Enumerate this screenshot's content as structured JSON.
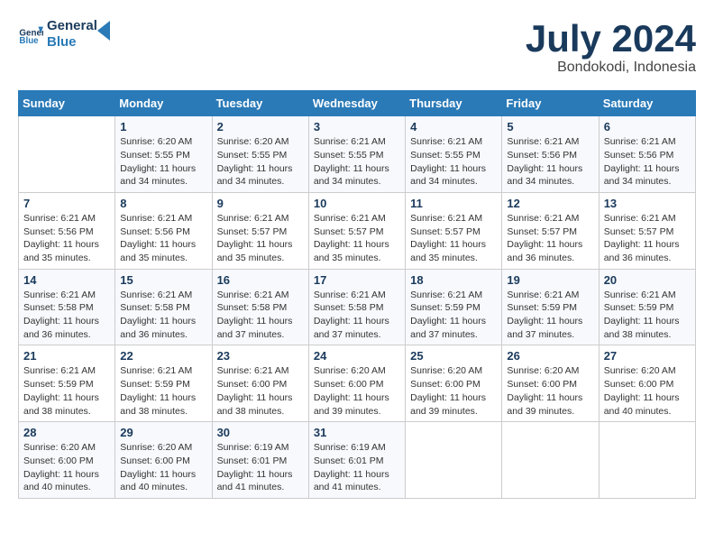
{
  "header": {
    "logo_line1": "General",
    "logo_line2": "Blue",
    "month_title": "July 2024",
    "location": "Bondokodi, Indonesia"
  },
  "weekdays": [
    "Sunday",
    "Monday",
    "Tuesday",
    "Wednesday",
    "Thursday",
    "Friday",
    "Saturday"
  ],
  "weeks": [
    [
      {
        "day": "",
        "info": ""
      },
      {
        "day": "1",
        "info": "Sunrise: 6:20 AM\nSunset: 5:55 PM\nDaylight: 11 hours\nand 34 minutes."
      },
      {
        "day": "2",
        "info": "Sunrise: 6:20 AM\nSunset: 5:55 PM\nDaylight: 11 hours\nand 34 minutes."
      },
      {
        "day": "3",
        "info": "Sunrise: 6:21 AM\nSunset: 5:55 PM\nDaylight: 11 hours\nand 34 minutes."
      },
      {
        "day": "4",
        "info": "Sunrise: 6:21 AM\nSunset: 5:55 PM\nDaylight: 11 hours\nand 34 minutes."
      },
      {
        "day": "5",
        "info": "Sunrise: 6:21 AM\nSunset: 5:56 PM\nDaylight: 11 hours\nand 34 minutes."
      },
      {
        "day": "6",
        "info": "Sunrise: 6:21 AM\nSunset: 5:56 PM\nDaylight: 11 hours\nand 34 minutes."
      }
    ],
    [
      {
        "day": "7",
        "info": "Sunrise: 6:21 AM\nSunset: 5:56 PM\nDaylight: 11 hours\nand 35 minutes."
      },
      {
        "day": "8",
        "info": "Sunrise: 6:21 AM\nSunset: 5:56 PM\nDaylight: 11 hours\nand 35 minutes."
      },
      {
        "day": "9",
        "info": "Sunrise: 6:21 AM\nSunset: 5:57 PM\nDaylight: 11 hours\nand 35 minutes."
      },
      {
        "day": "10",
        "info": "Sunrise: 6:21 AM\nSunset: 5:57 PM\nDaylight: 11 hours\nand 35 minutes."
      },
      {
        "day": "11",
        "info": "Sunrise: 6:21 AM\nSunset: 5:57 PM\nDaylight: 11 hours\nand 35 minutes."
      },
      {
        "day": "12",
        "info": "Sunrise: 6:21 AM\nSunset: 5:57 PM\nDaylight: 11 hours\nand 36 minutes."
      },
      {
        "day": "13",
        "info": "Sunrise: 6:21 AM\nSunset: 5:57 PM\nDaylight: 11 hours\nand 36 minutes."
      }
    ],
    [
      {
        "day": "14",
        "info": "Sunrise: 6:21 AM\nSunset: 5:58 PM\nDaylight: 11 hours\nand 36 minutes."
      },
      {
        "day": "15",
        "info": "Sunrise: 6:21 AM\nSunset: 5:58 PM\nDaylight: 11 hours\nand 36 minutes."
      },
      {
        "day": "16",
        "info": "Sunrise: 6:21 AM\nSunset: 5:58 PM\nDaylight: 11 hours\nand 37 minutes."
      },
      {
        "day": "17",
        "info": "Sunrise: 6:21 AM\nSunset: 5:58 PM\nDaylight: 11 hours\nand 37 minutes."
      },
      {
        "day": "18",
        "info": "Sunrise: 6:21 AM\nSunset: 5:59 PM\nDaylight: 11 hours\nand 37 minutes."
      },
      {
        "day": "19",
        "info": "Sunrise: 6:21 AM\nSunset: 5:59 PM\nDaylight: 11 hours\nand 37 minutes."
      },
      {
        "day": "20",
        "info": "Sunrise: 6:21 AM\nSunset: 5:59 PM\nDaylight: 11 hours\nand 38 minutes."
      }
    ],
    [
      {
        "day": "21",
        "info": "Sunrise: 6:21 AM\nSunset: 5:59 PM\nDaylight: 11 hours\nand 38 minutes."
      },
      {
        "day": "22",
        "info": "Sunrise: 6:21 AM\nSunset: 5:59 PM\nDaylight: 11 hours\nand 38 minutes."
      },
      {
        "day": "23",
        "info": "Sunrise: 6:21 AM\nSunset: 6:00 PM\nDaylight: 11 hours\nand 38 minutes."
      },
      {
        "day": "24",
        "info": "Sunrise: 6:20 AM\nSunset: 6:00 PM\nDaylight: 11 hours\nand 39 minutes."
      },
      {
        "day": "25",
        "info": "Sunrise: 6:20 AM\nSunset: 6:00 PM\nDaylight: 11 hours\nand 39 minutes."
      },
      {
        "day": "26",
        "info": "Sunrise: 6:20 AM\nSunset: 6:00 PM\nDaylight: 11 hours\nand 39 minutes."
      },
      {
        "day": "27",
        "info": "Sunrise: 6:20 AM\nSunset: 6:00 PM\nDaylight: 11 hours\nand 40 minutes."
      }
    ],
    [
      {
        "day": "28",
        "info": "Sunrise: 6:20 AM\nSunset: 6:00 PM\nDaylight: 11 hours\nand 40 minutes."
      },
      {
        "day": "29",
        "info": "Sunrise: 6:20 AM\nSunset: 6:00 PM\nDaylight: 11 hours\nand 40 minutes."
      },
      {
        "day": "30",
        "info": "Sunrise: 6:19 AM\nSunset: 6:01 PM\nDaylight: 11 hours\nand 41 minutes."
      },
      {
        "day": "31",
        "info": "Sunrise: 6:19 AM\nSunset: 6:01 PM\nDaylight: 11 hours\nand 41 minutes."
      },
      {
        "day": "",
        "info": ""
      },
      {
        "day": "",
        "info": ""
      },
      {
        "day": "",
        "info": ""
      }
    ]
  ]
}
